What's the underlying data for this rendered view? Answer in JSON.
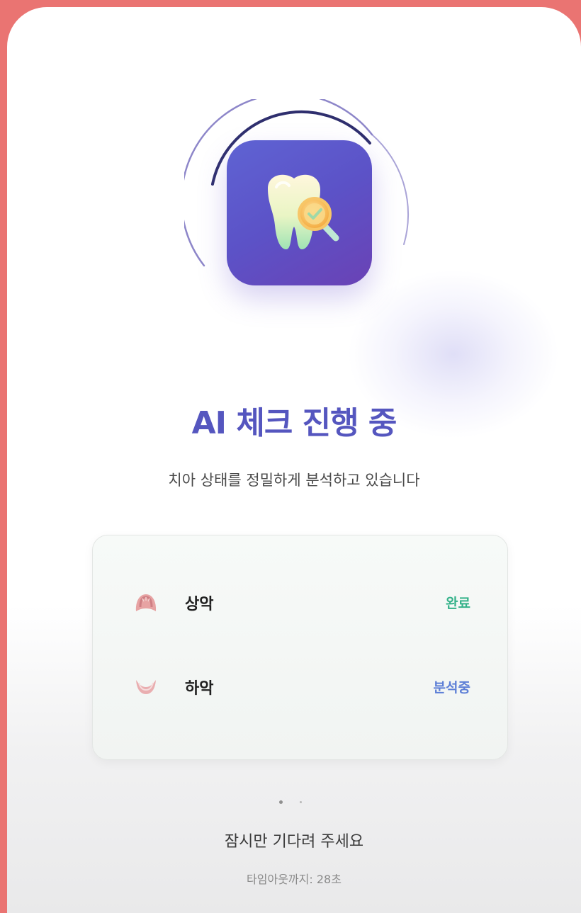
{
  "header": {
    "title": "AI 체크 진행 중",
    "subtitle": "치아 상태를 정밀하게 분석하고 있습니다"
  },
  "app_icon": {
    "icon": "tooth-magnifier-icon"
  },
  "status_card": {
    "items": [
      {
        "label": "상악",
        "status": "완료",
        "icon": "upper-jaw-icon",
        "status_color": "#35b28a"
      },
      {
        "label": "하악",
        "status": "분석중",
        "icon": "lower-jaw-icon",
        "status_color": "#5d7fd6"
      }
    ]
  },
  "footer": {
    "wait_message": "잠시만 기다려 주세요",
    "timeout": "타임아웃까지: 28초"
  },
  "colors": {
    "accent": "#5556bf",
    "background": "#ea7472"
  }
}
